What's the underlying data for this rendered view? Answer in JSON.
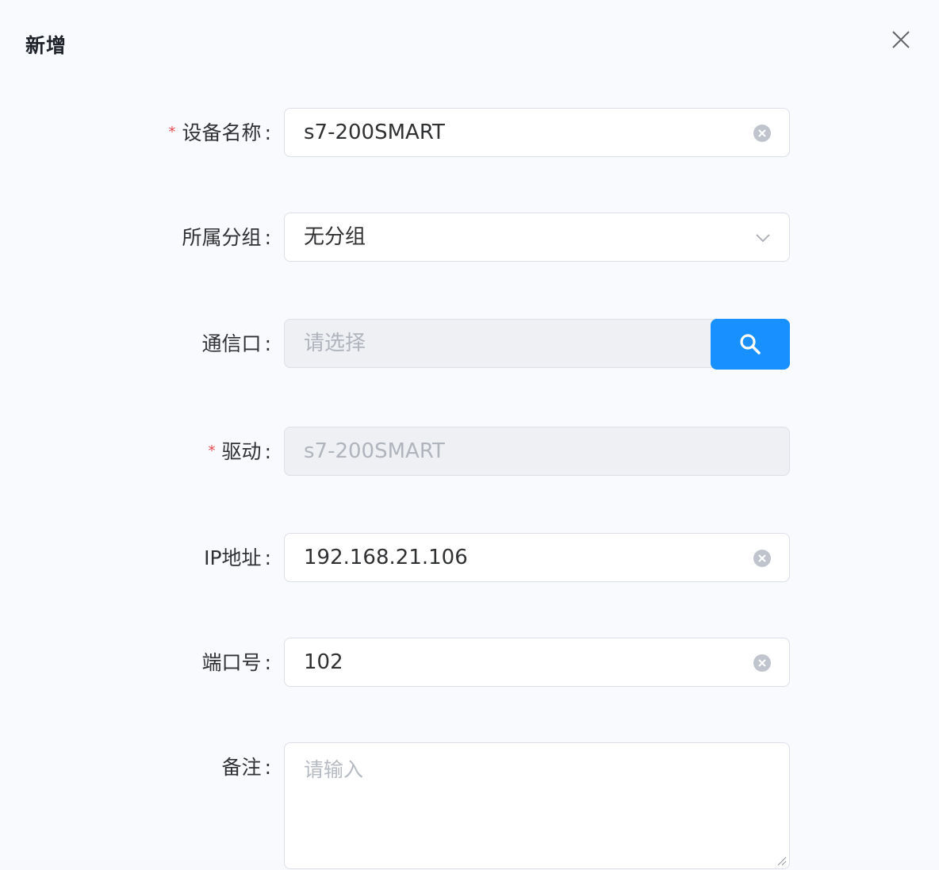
{
  "dialog": {
    "title": "新增",
    "close_icon": "close-icon"
  },
  "form": {
    "device_name": {
      "label": "设备名称",
      "required": "*",
      "value": "s7-200SMART"
    },
    "group": {
      "label": "所属分组",
      "value": "无分组"
    },
    "port_comm": {
      "label": "通信口",
      "placeholder": "请选择",
      "button_icon": "search-icon"
    },
    "driver": {
      "label": "驱动",
      "required": "*",
      "value": "s7-200SMART"
    },
    "ip": {
      "label": "IP地址",
      "value": "192.168.21.106"
    },
    "port_number": {
      "label": "端口号",
      "value": "102"
    },
    "remark": {
      "label": "备注",
      "placeholder": "请输入"
    },
    "colon": ":"
  },
  "colors": {
    "primary": "#1890ff",
    "required": "#e5484d"
  }
}
